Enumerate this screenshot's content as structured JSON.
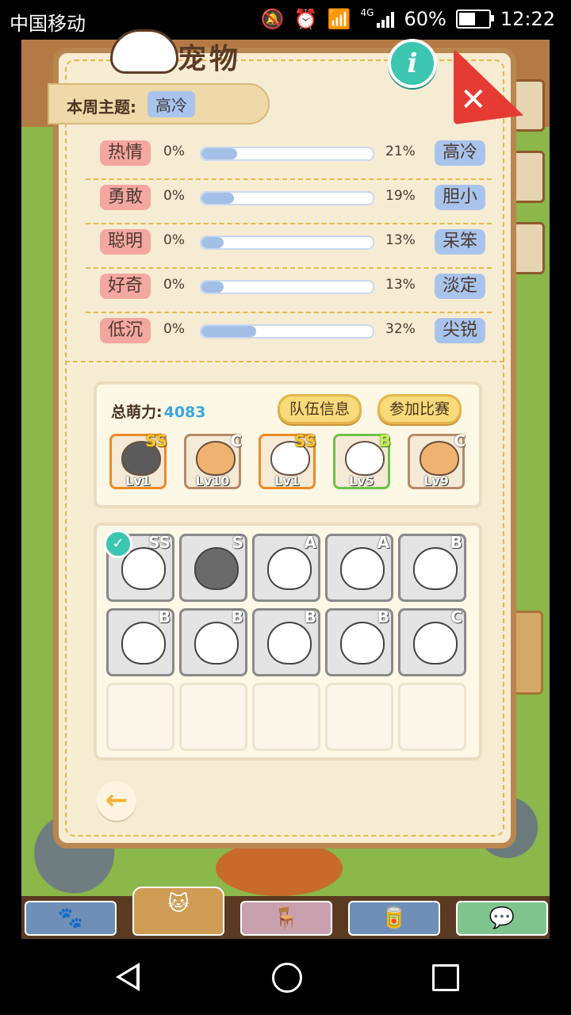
{
  "status_bar": {
    "carrier": "中国移动",
    "network": "4G",
    "battery": "60%",
    "battery_level": 0.6,
    "time": "12:22"
  },
  "panel": {
    "title": "宠物",
    "theme_label": "本周主题:",
    "theme_value": "高冷",
    "traits": [
      {
        "left": "热情",
        "left_pct": "0%",
        "right_pct": "21%",
        "right": "高冷",
        "fill": 0.21
      },
      {
        "left": "勇敢",
        "left_pct": "0%",
        "right_pct": "19%",
        "right": "胆小",
        "fill": 0.19
      },
      {
        "left": "聪明",
        "left_pct": "0%",
        "right_pct": "13%",
        "right": "呆笨",
        "fill": 0.13
      },
      {
        "left": "好奇",
        "left_pct": "0%",
        "right_pct": "13%",
        "right": "淡定",
        "fill": 0.13
      },
      {
        "left": "低沉",
        "left_pct": "0%",
        "right_pct": "32%",
        "right": "尖锐",
        "fill": 0.32
      }
    ],
    "team": {
      "power_label": "总萌力:",
      "power_value": "4083",
      "team_info_button": "队伍信息",
      "join_button": "参加比赛",
      "members": [
        {
          "rank": "SS",
          "level": "Lv1"
        },
        {
          "rank": "C",
          "level": "Lv10"
        },
        {
          "rank": "SS",
          "level": "Lv1"
        },
        {
          "rank": "B",
          "level": "Lv5"
        },
        {
          "rank": "C",
          "level": "Lv9"
        }
      ]
    },
    "inventory": {
      "cats": [
        {
          "rank": "SS",
          "selected": true
        },
        {
          "rank": "S"
        },
        {
          "rank": "A"
        },
        {
          "rank": "A"
        },
        {
          "rank": "B"
        },
        {
          "rank": "B"
        },
        {
          "rank": "B"
        },
        {
          "rank": "B"
        },
        {
          "rank": "B"
        },
        {
          "rank": "C"
        }
      ]
    }
  },
  "icons": {
    "info": "i",
    "close": "✕",
    "check": "✓",
    "back": "←"
  },
  "colors": {
    "accent_teal": "#3cc6b0",
    "close_red": "#e63b32",
    "tag_pink": "#f4a7a0",
    "tag_blue": "#a9c4ec"
  }
}
